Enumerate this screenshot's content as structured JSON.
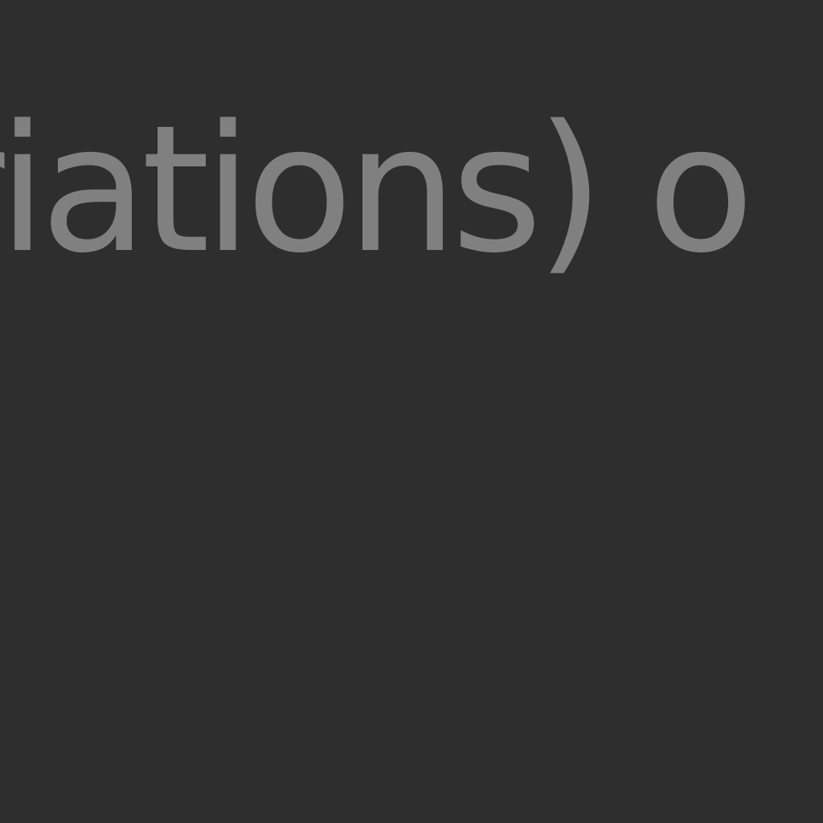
{
  "canvas": {
    "background_color": "#2e2e2e",
    "text_color": "#808080",
    "visible_text": "riations) o"
  }
}
